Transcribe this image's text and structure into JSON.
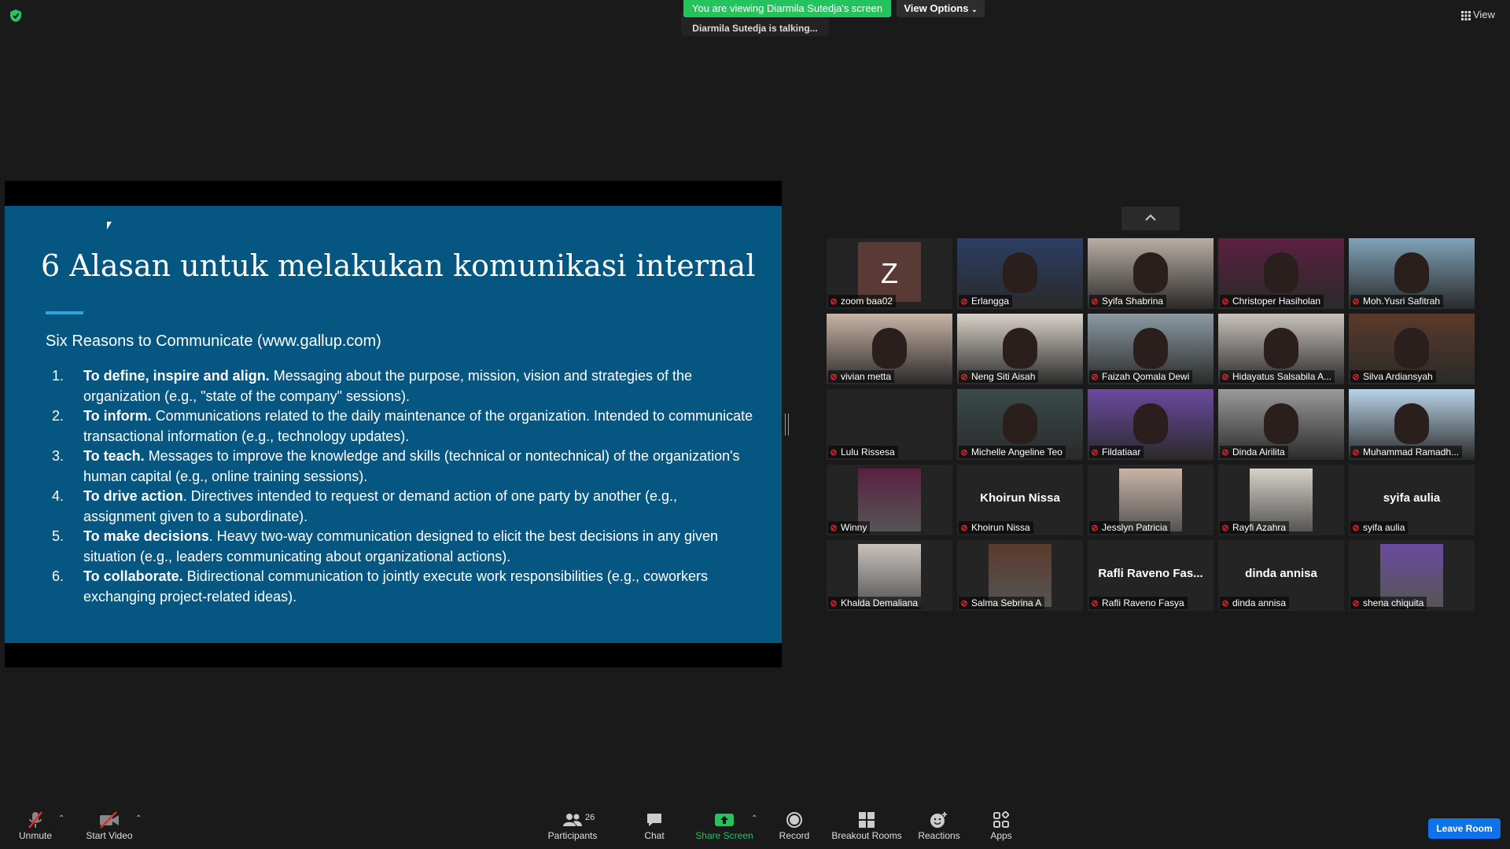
{
  "top": {
    "banner": "You are viewing Diarmila Sutedja's screen",
    "talking": "Diarmila Sutedja is talking...",
    "view_options": "View Options",
    "view_button": "View"
  },
  "slide": {
    "title": "6 Alasan untuk melakukan komunikasi internal",
    "subtitle": "Six Reasons to Communicate (www.gallup.com)",
    "reasons": [
      {
        "num": "1.",
        "bold": "To define, inspire and align.",
        "text": " Messaging about the purpose, mission, vision and strategies of the organization (e.g., \"state of the company\" sessions)."
      },
      {
        "num": "2.",
        "bold": "To inform.",
        "text": " Communications related to the daily maintenance of the organization. Intended to communicate transactional information (e.g., technology updates)."
      },
      {
        "num": "3.",
        "bold": "To teach.",
        "text": " Messages to improve the knowledge and skills (technical or nontechnical) of the organization's human capital (e.g., online training sessions)."
      },
      {
        "num": "4.",
        "bold": "To drive action",
        "text": ". Directives intended to request or demand action of one party by another (e.g., assignment given to a subordinate)."
      },
      {
        "num": "5.",
        "bold": "To make decisions",
        "text": ". Heavy two-way communication designed to elicit the best decisions in any given situation (e.g., leaders communicating about organizational actions)."
      },
      {
        "num": "6.",
        "bold": "To collaborate.",
        "text": " Bidirectional communication to jointly execute work responsibilities (e.g., coworkers exchanging project-related ideas)."
      }
    ]
  },
  "participants": [
    {
      "label": "zoom baa02",
      "type": "avatar",
      "avatar": "Z"
    },
    {
      "label": "Erlangga",
      "type": "video"
    },
    {
      "label": "Syifa Shabrina",
      "type": "video"
    },
    {
      "label": "Christoper Hasiholan",
      "type": "video"
    },
    {
      "label": "Moh.Yusri Safitrah",
      "type": "video"
    },
    {
      "label": "vivian metta",
      "type": "video"
    },
    {
      "label": "Neng Siti Aisah",
      "type": "video"
    },
    {
      "label": "Faizah Qomala Dewi",
      "type": "video"
    },
    {
      "label": "Hidayatus Salsabila A...",
      "type": "video"
    },
    {
      "label": "Silva Ardiansyah",
      "type": "video"
    },
    {
      "label": "Lulu Rissesa",
      "type": "blank"
    },
    {
      "label": "Michelle Angeline Teo",
      "type": "video"
    },
    {
      "label": "Fildatiaar",
      "type": "video"
    },
    {
      "label": "Dinda Airilita",
      "type": "video"
    },
    {
      "label": "Muhammad Ramadh...",
      "type": "video"
    },
    {
      "label": "Winny",
      "type": "photo"
    },
    {
      "label": "Khoirun Nissa",
      "type": "name",
      "bigname": "Khoirun Nissa"
    },
    {
      "label": "Jesslyn Patricia",
      "type": "photo"
    },
    {
      "label": "Rayfi Azahra",
      "type": "photo"
    },
    {
      "label": "syifa aulia",
      "type": "name",
      "bigname": "syifa aulia"
    },
    {
      "label": "Khalda Demaliana",
      "type": "photo"
    },
    {
      "label": "Salma Sebrina A",
      "type": "photo"
    },
    {
      "label": "Rafli Raveno Fasya",
      "type": "name",
      "bigname": "Rafli Raveno Fas..."
    },
    {
      "label": "dinda annisa",
      "type": "name",
      "bigname": "dinda annisa"
    },
    {
      "label": "shena chiquita",
      "type": "photo"
    }
  ],
  "toolbar": {
    "unmute": "Unmute",
    "start_video": "Start Video",
    "participants": "Participants",
    "participants_count": "26",
    "chat": "Chat",
    "share_screen": "Share Screen",
    "record": "Record",
    "breakout_rooms": "Breakout Rooms",
    "reactions": "Reactions",
    "apps": "Apps",
    "leave_room": "Leave Room"
  },
  "colors": {
    "slide_bg": "#065682",
    "accent": "#2aa7e1",
    "banner": "#23c45e",
    "leave": "#0e72ed",
    "share": "#23c45e",
    "muted": "#e02b2b"
  }
}
